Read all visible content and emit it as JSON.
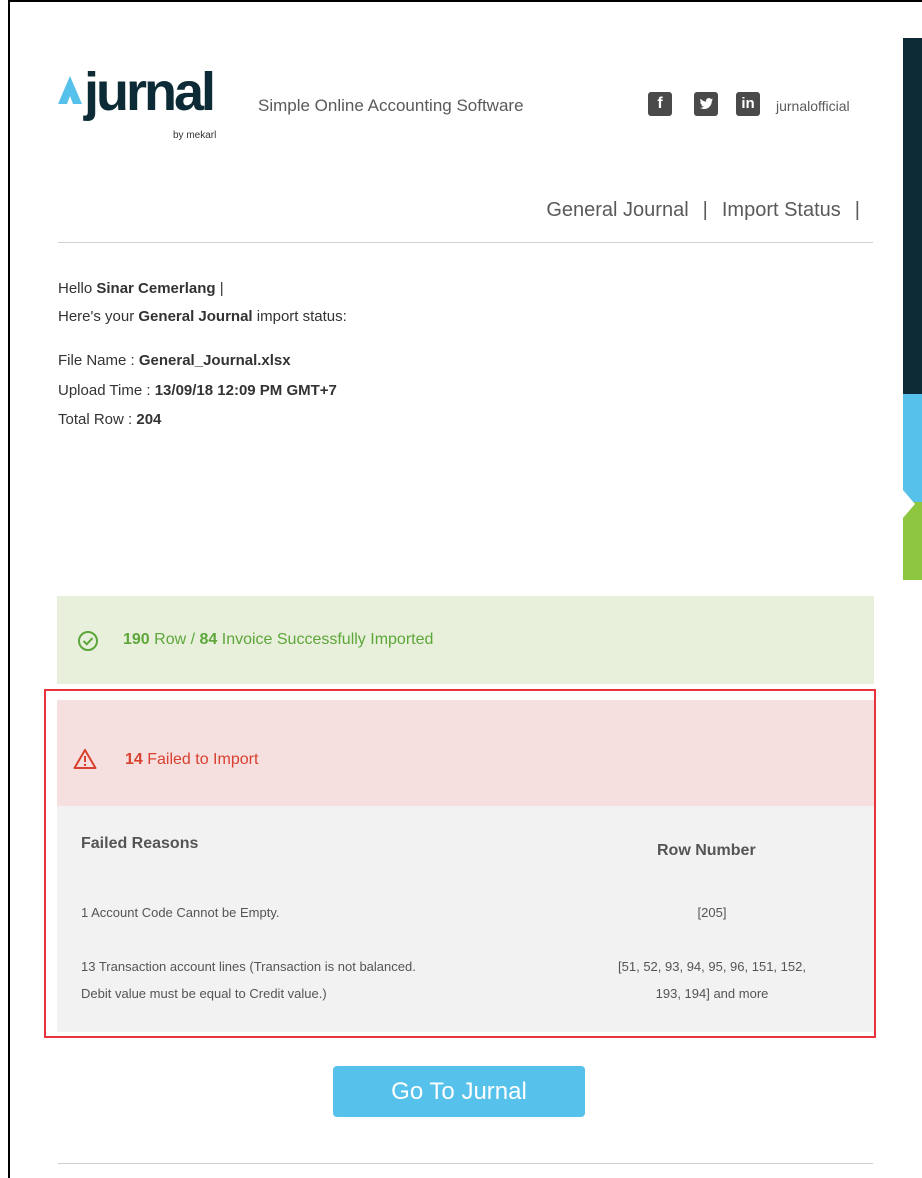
{
  "header": {
    "logo_word": "jurnal",
    "logo_by": "by mekarl",
    "tagline": "Simple Online Accounting Software",
    "social": [
      {
        "icon": "facebook-icon",
        "glyph": "f"
      },
      {
        "icon": "twitter-icon",
        "glyph": "t"
      },
      {
        "icon": "linkedin-icon",
        "glyph": "in"
      }
    ],
    "handle": "jurnalofficial"
  },
  "nav": {
    "item1": "General Journal",
    "sep": "|",
    "item2": "Import Status",
    "trail": "|"
  },
  "greeting": {
    "hello_prefix": "Hello ",
    "user": "Sinar Cemerlang",
    "hello_suffix": " |",
    "status_prefix": "Here's your ",
    "status_bold": "General Journal",
    "status_suffix": " import status:",
    "file_label": "File Name : ",
    "file_value": "General_Journal.xlsx",
    "upload_label": "Upload Time : ",
    "upload_value": "13/09/18 12:09 PM GMT+7",
    "total_label": "Total Row : ",
    "total_value": "204"
  },
  "success": {
    "rows": "190",
    "rows_label": " Row / ",
    "invoices": "84",
    "invoices_label": " Invoice Successfully Imported"
  },
  "failed": {
    "count": "14",
    "label": " Failed to Import",
    "col_reason": "Failed Reasons",
    "col_rows": "Row Number",
    "rows": [
      {
        "reason_line1": "1 Account Code Cannot be Empty.",
        "reason_line2": "",
        "rows_line1": "[205]",
        "rows_line2": ""
      },
      {
        "reason_line1": "13 Transaction account lines (Transaction is not balanced.",
        "reason_line2": "Debit value must be equal to Credit value.)",
        "rows_line1": "[51, 52, 93, 94, 95, 96, 151, 152,",
        "rows_line2": "193, 194] and more"
      }
    ]
  },
  "button": {
    "label": "Go To Jurnal"
  },
  "colors": {
    "brand_dark": "#0d2b36",
    "brand_blue": "#56c1ea",
    "brand_green": "#8dc63f",
    "success_text": "#5da63a",
    "error_text": "#d8412f",
    "highlight_border": "#e8333c"
  }
}
